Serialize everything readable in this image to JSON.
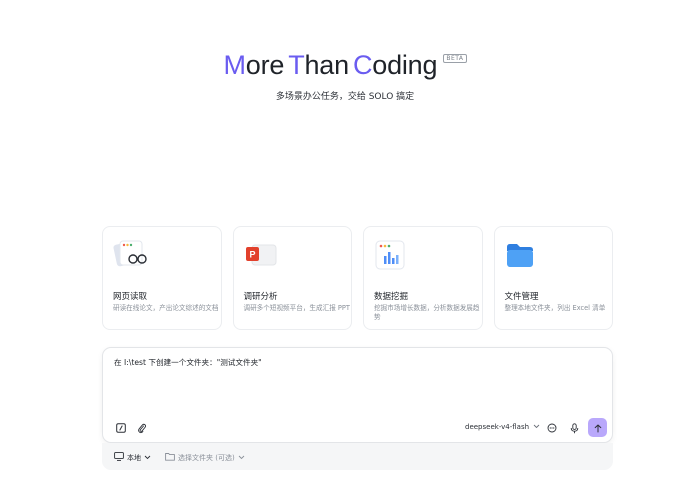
{
  "hero": {
    "title_parts": [
      {
        "cap": "M",
        "rest": "ore"
      },
      {
        "cap": "T",
        "rest": "han"
      },
      {
        "cap": "C",
        "rest": "oding"
      }
    ],
    "badge": "BETA",
    "subtitle": "多场景办公任务，交给 SOLO 搞定"
  },
  "cards": [
    {
      "title": "网页读取",
      "desc": "研读在线论文，产出论文综述的文档",
      "icon": "web-reading-icon"
    },
    {
      "title": "调研分析",
      "desc": "调研多个短视频平台，生成汇报 PPT",
      "icon": "ppt-icon"
    },
    {
      "title": "数据挖掘",
      "desc": "挖掘市场增长数据，分析数据发展趋势",
      "icon": "bar-chart-icon"
    },
    {
      "title": "文件管理",
      "desc": "整理本地文件夹，列出 Excel 清单",
      "icon": "folder-icon"
    }
  ],
  "composer": {
    "prompt": "在 I:\\test 下创建一个文件夹：\"测试文件夹\"",
    "model": "deepseek-v4-flash"
  },
  "footer": {
    "location": "本地",
    "folder_placeholder": "选择文件夹 (可选)"
  },
  "colors": {
    "accent": "#6a5cf0",
    "send": "#b9a8fb"
  }
}
